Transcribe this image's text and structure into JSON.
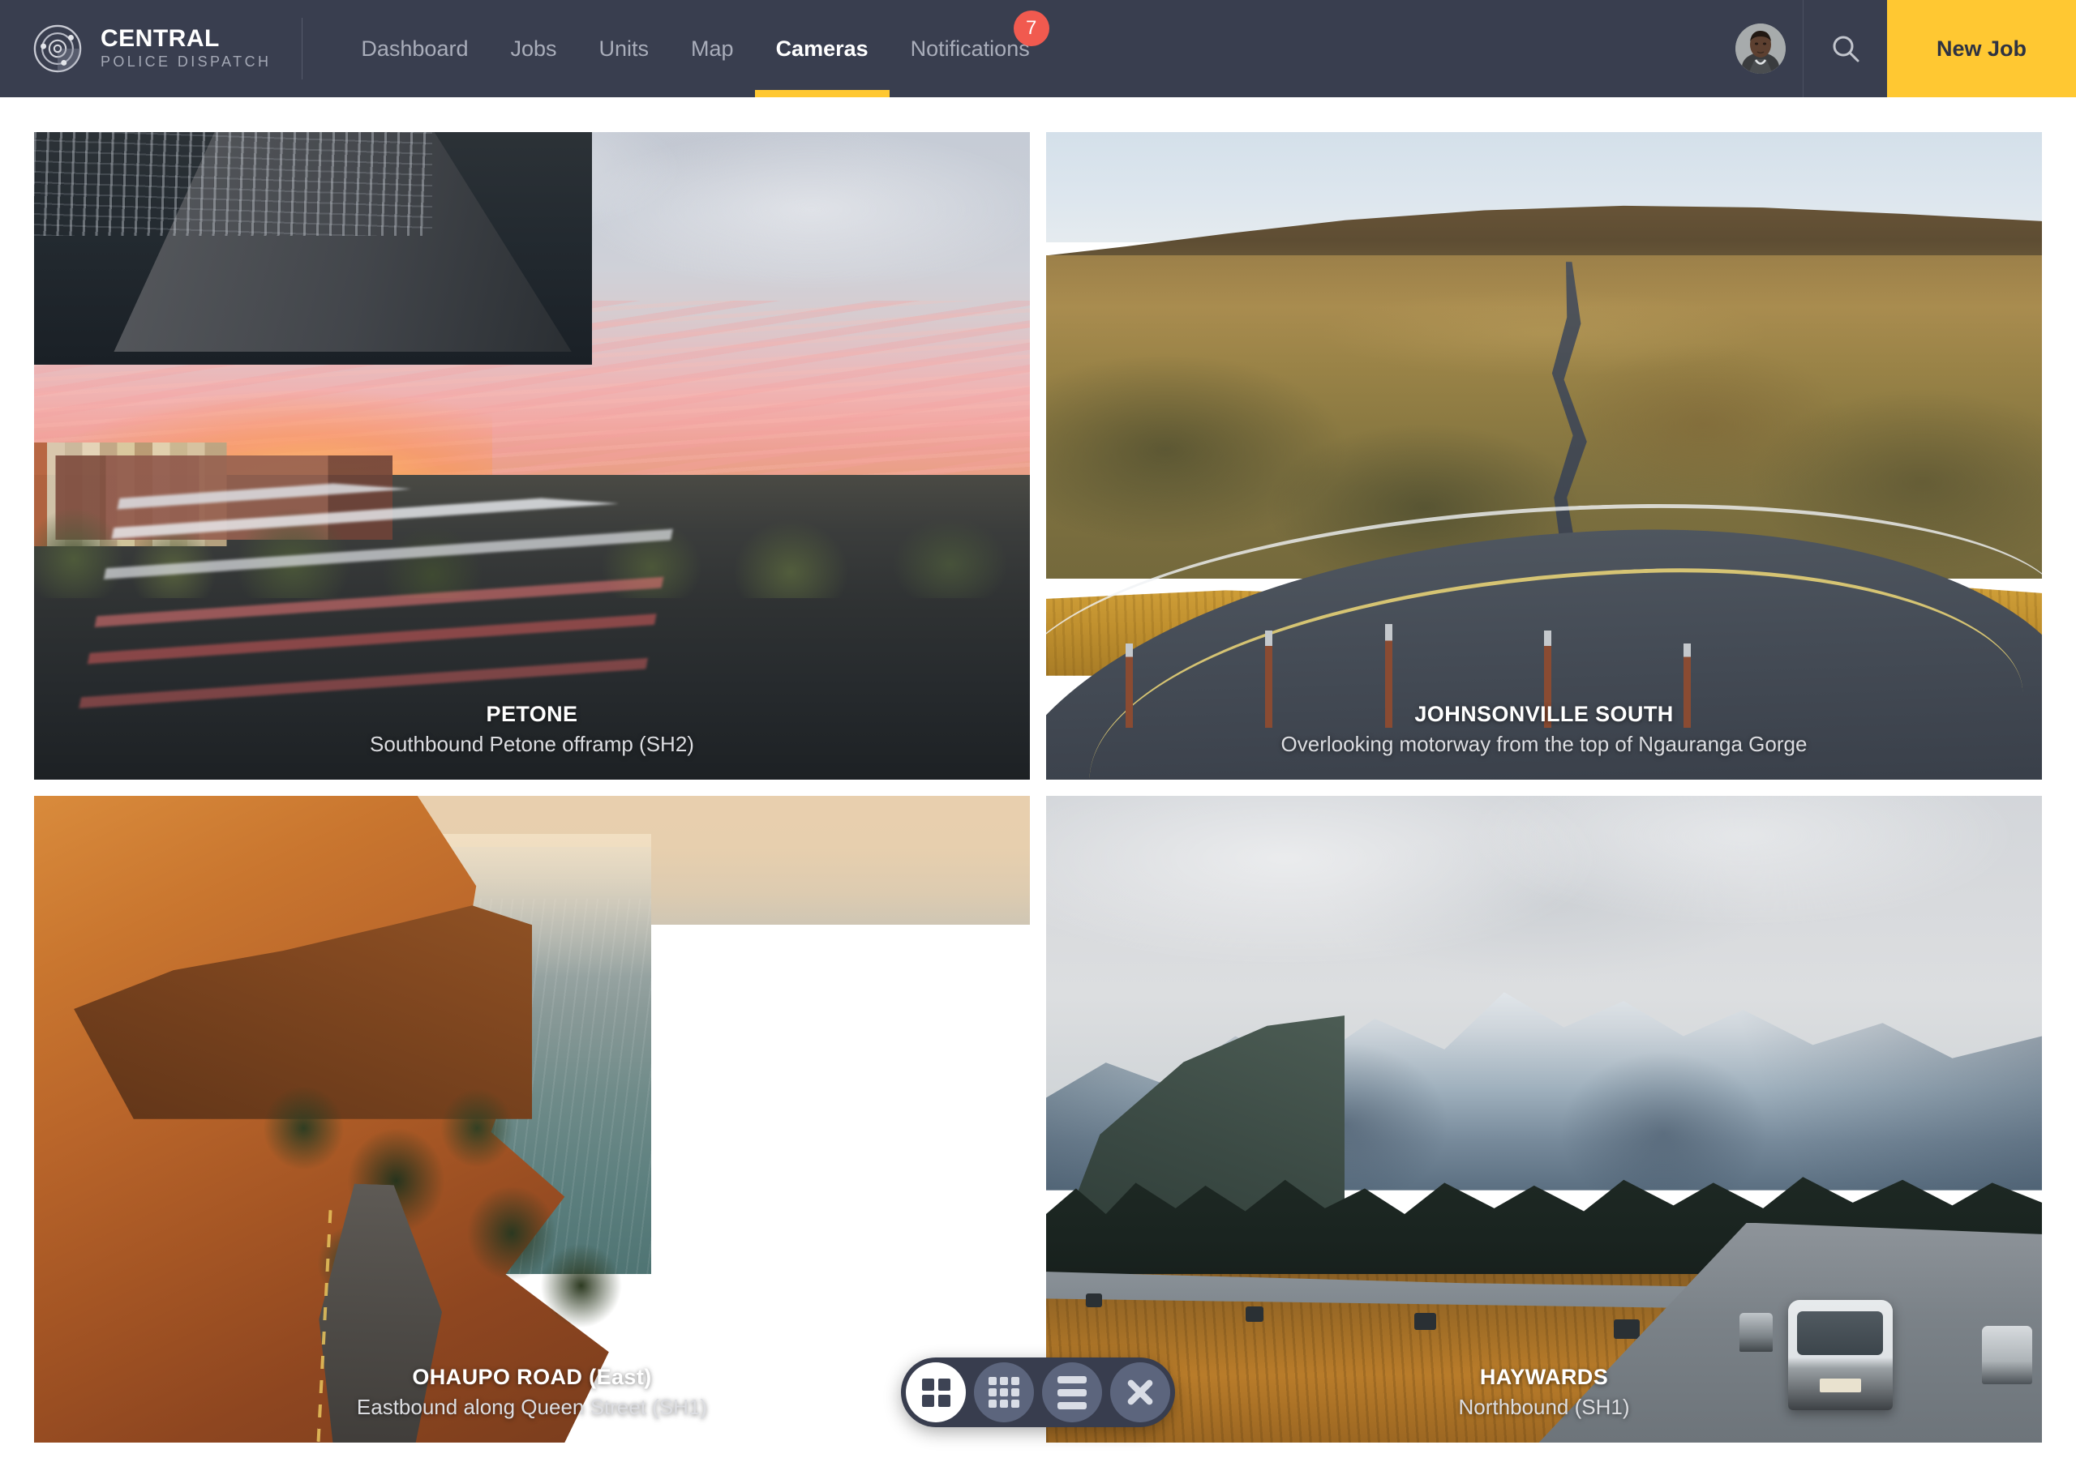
{
  "header": {
    "brand": {
      "title": "CENTRAL",
      "subtitle": "POLICE DISPATCH",
      "logo_icon": "radar-orbit-icon"
    },
    "nav": [
      {
        "label": "Dashboard",
        "active": false
      },
      {
        "label": "Jobs",
        "active": false
      },
      {
        "label": "Units",
        "active": false
      },
      {
        "label": "Map",
        "active": false
      },
      {
        "label": "Cameras",
        "active": true
      },
      {
        "label": "Notifications",
        "active": false,
        "badge": "7"
      }
    ],
    "avatar_icon": "user-avatar",
    "search_icon": "search-icon",
    "new_job_label": "New Job",
    "colors": {
      "header_bg": "#393e4f",
      "accent_yellow": "#ffc832",
      "badge_red": "#f15a4f",
      "nav_inactive": "#a9adba"
    }
  },
  "cameras": [
    {
      "name": "PETONE",
      "description": "Southbound Petone offramp (SH2)",
      "scene": "city-motorway-sunset"
    },
    {
      "name": "JOHNSONVILLE SOUTH",
      "description": "Overlooking motorway from the top of Ngauranga Gorge",
      "scene": "golden-hills-winding-road"
    },
    {
      "name": "OHAUPO ROAD (East)",
      "description": "Eastbound along Queen Street (SH1)",
      "scene": "coastal-cliff-sunset"
    },
    {
      "name": "HAYWARDS",
      "description": "Northbound (SH1)",
      "scene": "snowy-mountain-highway"
    }
  ],
  "view_controls": [
    {
      "icon": "grid-2x2-icon",
      "active": true
    },
    {
      "icon": "grid-3x3-icon",
      "active": false
    },
    {
      "icon": "list-view-icon",
      "active": false
    },
    {
      "icon": "close-icon",
      "active": false
    }
  ]
}
